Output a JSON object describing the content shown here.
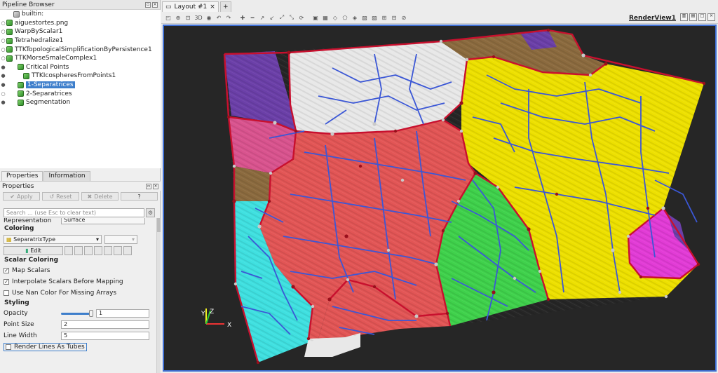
{
  "pipeline_browser": {
    "title": "Pipeline Browser",
    "items": [
      {
        "label": "builtin:",
        "indent": 0,
        "eye": "",
        "kind": "server",
        "selected": false
      },
      {
        "label": "aiguestortes.png",
        "indent": 0,
        "eye": "○",
        "kind": "filter",
        "selected": false
      },
      {
        "label": "WarpByScalar1",
        "indent": 0,
        "eye": "○",
        "kind": "filter",
        "selected": false
      },
      {
        "label": "Tetrahedralize1",
        "indent": 0,
        "eye": "○",
        "kind": "filter",
        "selected": false
      },
      {
        "label": "TTKTopologicalSimplificationByPersistence1",
        "indent": 0,
        "eye": "○",
        "kind": "filter",
        "selected": false
      },
      {
        "label": "TTKMorseSmaleComplex1",
        "indent": 0,
        "eye": "○",
        "kind": "filter",
        "selected": false
      },
      {
        "label": "Critical Points",
        "indent": 1,
        "eye": "●",
        "kind": "filter",
        "selected": false
      },
      {
        "label": "TTKIcospheresFromPoints1",
        "indent": 2,
        "eye": "●",
        "kind": "filter",
        "selected": false
      },
      {
        "label": "1-Separatrices",
        "indent": 1,
        "eye": "●",
        "kind": "filter",
        "selected": true
      },
      {
        "label": "2-Separatrices",
        "indent": 1,
        "eye": "○",
        "kind": "filter",
        "selected": false
      },
      {
        "label": "Segmentation",
        "indent": 1,
        "eye": "●",
        "kind": "filter",
        "selected": false
      }
    ]
  },
  "tabs": {
    "properties": "Properties",
    "information": "Information"
  },
  "properties": {
    "title": "Properties",
    "apply": "Apply",
    "reset": "Reset",
    "delete": "Delete",
    "help": "?",
    "search_placeholder": "Search ... (use Esc to clear text)",
    "representation_label": "Representation",
    "representation_value": "Surface",
    "coloring_section": "Coloring",
    "color_array": "SeparatrixType",
    "edit": "Edit",
    "scalar_coloring_section": "Scalar Coloring",
    "map_scalars": "Map Scalars",
    "interpolate": "Interpolate Scalars Before Mapping",
    "nan_color": "Use Nan Color For Missing Arrays",
    "styling_section": "Styling",
    "opacity_label": "Opacity",
    "opacity_value": "1",
    "point_size_label": "Point Size",
    "point_size_value": "2",
    "line_width_label": "Line Width",
    "line_width_value": "5",
    "tubes": "Render Lines As Tubes"
  },
  "layout": {
    "tab": "Layout #1",
    "close": "×",
    "plus": "+",
    "render_view": "RenderView1",
    "toolbar_3d": "3D"
  },
  "axes": {
    "x": "X",
    "y": "Y",
    "z": "Z"
  },
  "colors": {
    "selection": "#3d7ecb",
    "view_border": "#3f6fd3",
    "separatrix_blue": "#3b57d6",
    "separatrix_red": "#c8102e",
    "region_red": "#e25555",
    "region_yellow": "#ede000",
    "region_green": "#3fd14b",
    "region_cyan": "#3fe0e0",
    "region_white": "#e8e8e8",
    "region_magenta": "#e23bd6",
    "region_purple": "#6b3fa8",
    "region_brown": "#8b6a3e",
    "region_pink": "#d9538e"
  }
}
